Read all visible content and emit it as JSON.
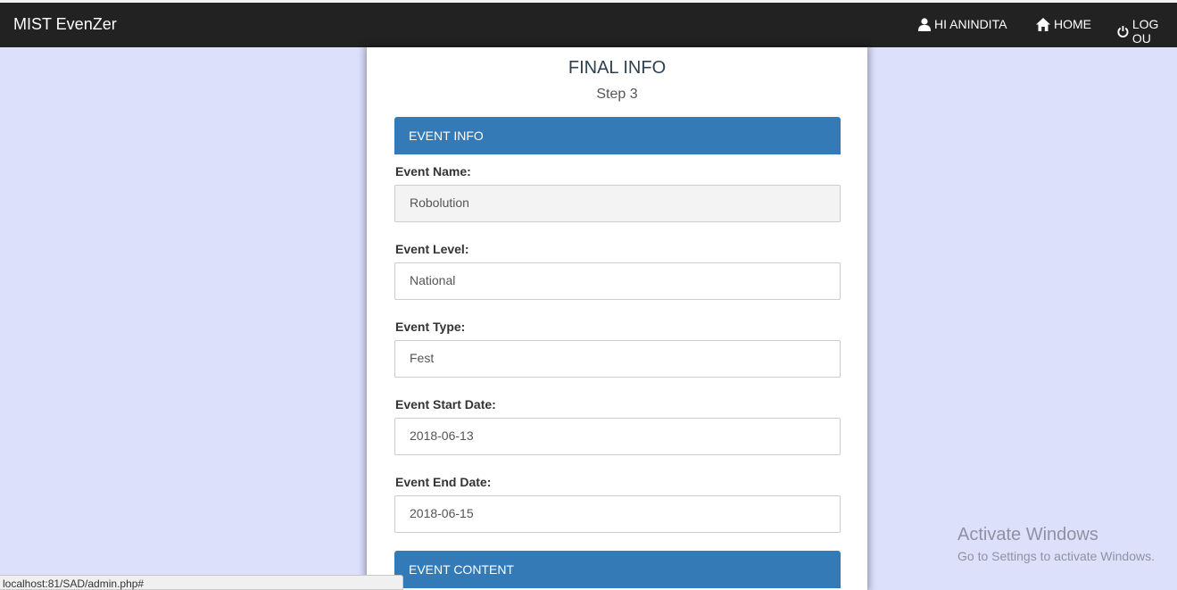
{
  "navbar": {
    "brand": "MIST EvenZer",
    "user_label": "HI ANINDITA",
    "home_label": "HOME",
    "logout_label": "LOG OU"
  },
  "form": {
    "title": "FINAL INFO",
    "step": "Step 3",
    "section_event_info": "EVENT INFO",
    "section_event_content": "EVENT CONTENT",
    "fields": [
      {
        "label": "Event Name:",
        "value": "Robolution"
      },
      {
        "label": "Event Level:",
        "value": "National"
      },
      {
        "label": "Event Type:",
        "value": "Fest"
      },
      {
        "label": "Event Start Date:",
        "value": "2018-06-13"
      },
      {
        "label": "Event End Date:",
        "value": "2018-06-15"
      }
    ]
  },
  "watermark": {
    "line1": "Activate Windows",
    "line2": "Go to Settings to activate Windows."
  },
  "statusbar": {
    "url": "localhost:81/SAD/admin.php#"
  },
  "colors": {
    "navbar_bg": "#222222",
    "page_bg": "#dce0fb",
    "panel_head": "#337ab7"
  }
}
